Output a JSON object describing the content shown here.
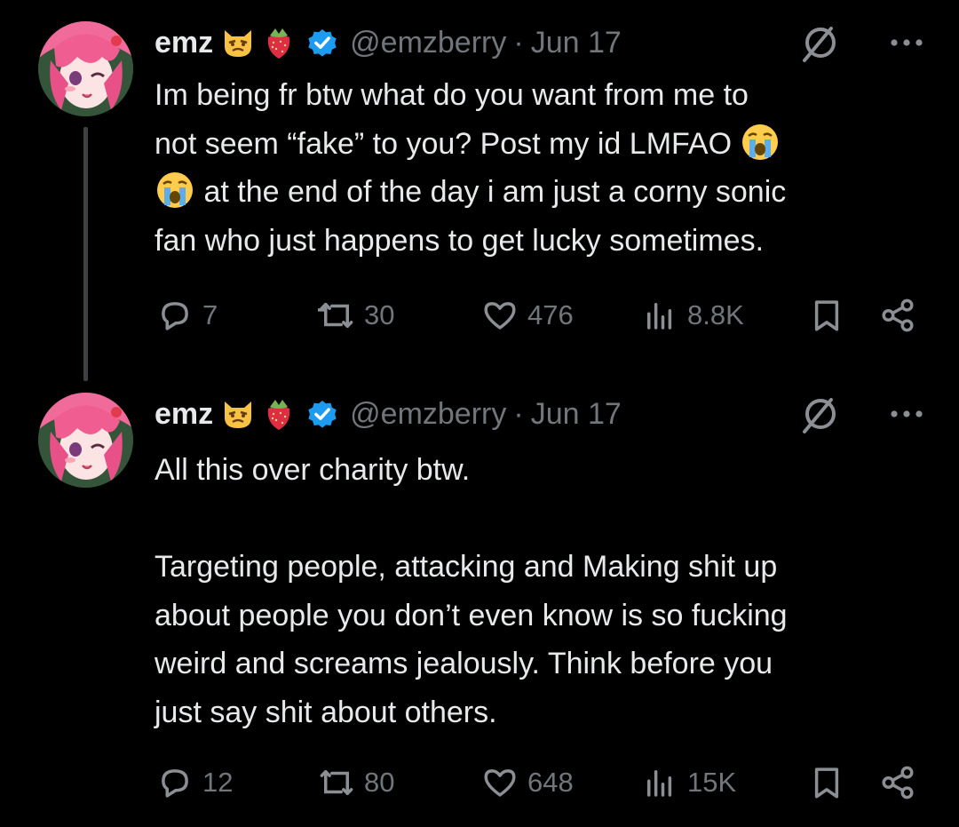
{
  "tweets": [
    {
      "name": "emz",
      "handle": "@emzberry",
      "dot": "·",
      "date": "Jun 17",
      "text_parts": [
        "Im being fr btw what do you want from me to\nnot seem “fake” to you? Post my id LMFAO ",
        "\n",
        " at the end of the day i am just a corny sonic\nfan who just happens to get lucky sometimes."
      ],
      "stats": {
        "replies": "7",
        "reposts": "30",
        "likes": "476",
        "views": "8.8K"
      }
    },
    {
      "name": "emz",
      "handle": "@emzberry",
      "dot": "·",
      "date": "Jun 17",
      "text": "All this over charity btw.\n\nTargeting people, attacking and Making shit up\nabout people you don’t even know is so fucking\nweird and screams jealously. Think before you\njust say shit about others.",
      "stats": {
        "replies": "12",
        "reposts": "80",
        "likes": "648",
        "views": "15K"
      }
    }
  ],
  "colors": {
    "background": "#000000",
    "text": "#e7e9ea",
    "muted": "#71767b",
    "verified": "#1d9bf0",
    "thread_line": "#3e4144"
  },
  "icons": [
    "cat-emoji-icon",
    "strawberry-emoji-icon",
    "verified-badge-icon",
    "grok-icon",
    "more-icon",
    "crying-emoji-icon",
    "reply-icon",
    "repost-icon",
    "like-icon",
    "views-icon",
    "bookmark-icon",
    "share-icon"
  ]
}
